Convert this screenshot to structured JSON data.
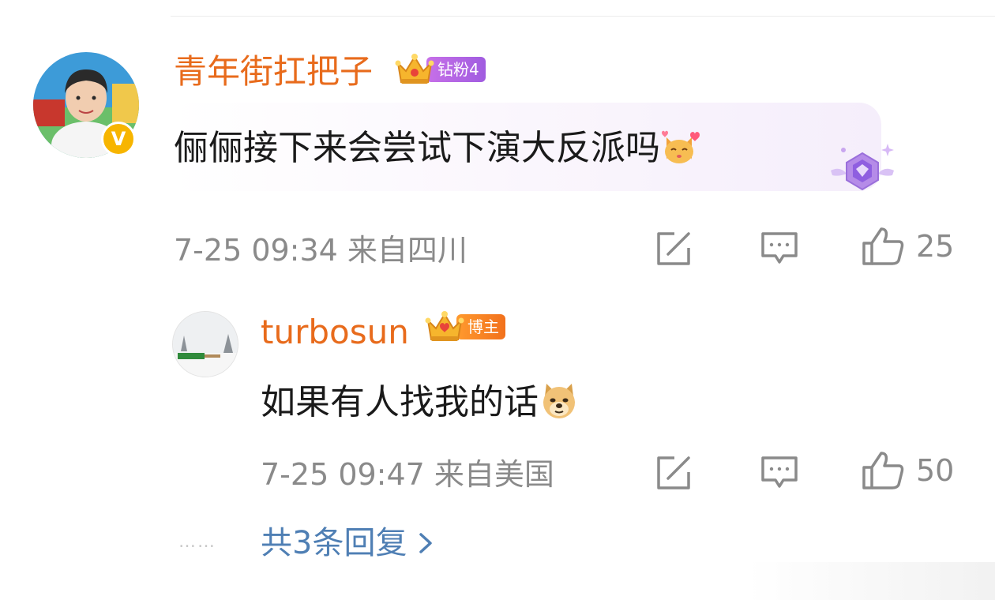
{
  "comment": {
    "username": "青年街扛把子",
    "fan_badge_label": "钻粉4",
    "verified_mark": "V",
    "text": "俪俪接下来会尝试下演大反派吗",
    "emoji": "cat-heart-emoji",
    "decoration": "diamond-gem-icon",
    "meta": "7-25 09:34 来自四川",
    "likes": "25"
  },
  "reply": {
    "username": "turbosun",
    "badge_label": "博主",
    "text": "如果有人找我的话",
    "emoji": "doge-emoji",
    "meta": "7-25 09:47 来自美国",
    "likes": "50"
  },
  "thread": {
    "dots": "……",
    "more_replies_label": "共3条回复"
  },
  "colors": {
    "username": "#e86b1c",
    "fan_badge": "#b566e4",
    "blogger_badge": "#f2711c",
    "verified": "#f7b500",
    "link": "#4f7fb4",
    "meta": "#8a8a8a"
  },
  "icons": [
    "share-icon",
    "comment-icon",
    "like-icon",
    "crown-icon",
    "chevron-right-icon"
  ]
}
